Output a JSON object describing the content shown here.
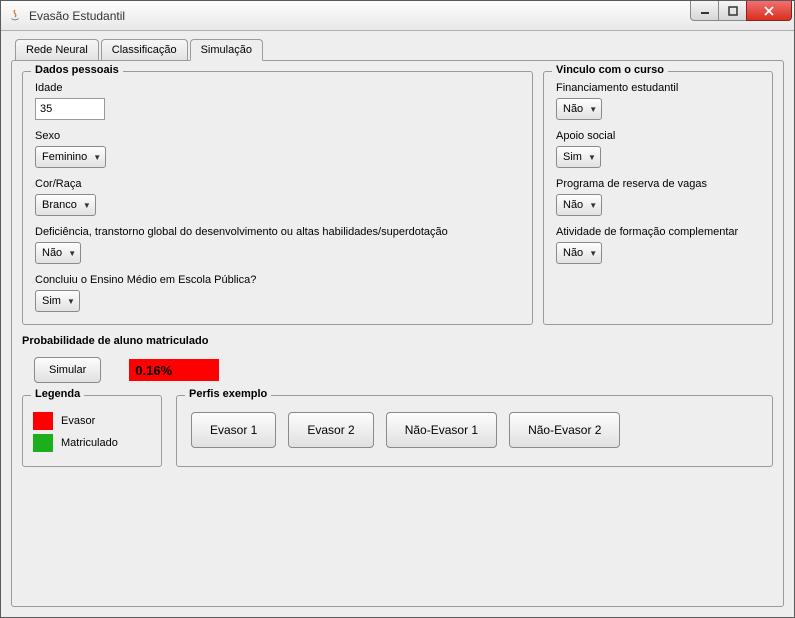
{
  "window": {
    "title": "Evasão Estudantil"
  },
  "tabs": [
    {
      "label": "Rede Neural",
      "active": false
    },
    {
      "label": "Classificação",
      "active": false
    },
    {
      "label": "Simulação",
      "active": true
    }
  ],
  "groups": {
    "dados_pessoais": {
      "title": "Dados pessoais",
      "fields": {
        "idade": {
          "label": "Idade",
          "value": "35"
        },
        "sexo": {
          "label": "Sexo",
          "value": "Feminino"
        },
        "cor_raca": {
          "label": "Cor/Raça",
          "value": "Branco"
        },
        "deficiencia": {
          "label": "Deficiência, transtorno global do desenvolvimento ou altas habilidades/superdotação",
          "value": "Não"
        },
        "ensino_medio": {
          "label": "Concluiu o Ensino Médio em Escola Pública?",
          "value": "Sim"
        }
      }
    },
    "vinculo": {
      "title": "Vinculo com o curso",
      "fields": {
        "financiamento": {
          "label": "Financiamento estudantil",
          "value": "Não"
        },
        "apoio_social": {
          "label": "Apoio social",
          "value": "Sim"
        },
        "reserva_vagas": {
          "label": "Programa de reserva de vagas",
          "value": "Não"
        },
        "atividade_complementar": {
          "label": "Atividade de formação complementar",
          "value": "Não"
        }
      }
    }
  },
  "probability": {
    "section_title": "Probabilidade de aluno matriculado",
    "simulate_label": "Simular",
    "value": "0.16%",
    "status_color": "#ff0000"
  },
  "legend": {
    "title": "Legenda",
    "items": [
      {
        "label": "Evasor",
        "color": "#ff0000"
      },
      {
        "label": "Matriculado",
        "color": "#1bb01b"
      }
    ]
  },
  "profiles": {
    "title": "Perfis exemplo",
    "buttons": [
      "Evasor 1",
      "Evasor 2",
      "Não-Evasor 1",
      "Não-Evasor 2"
    ]
  }
}
